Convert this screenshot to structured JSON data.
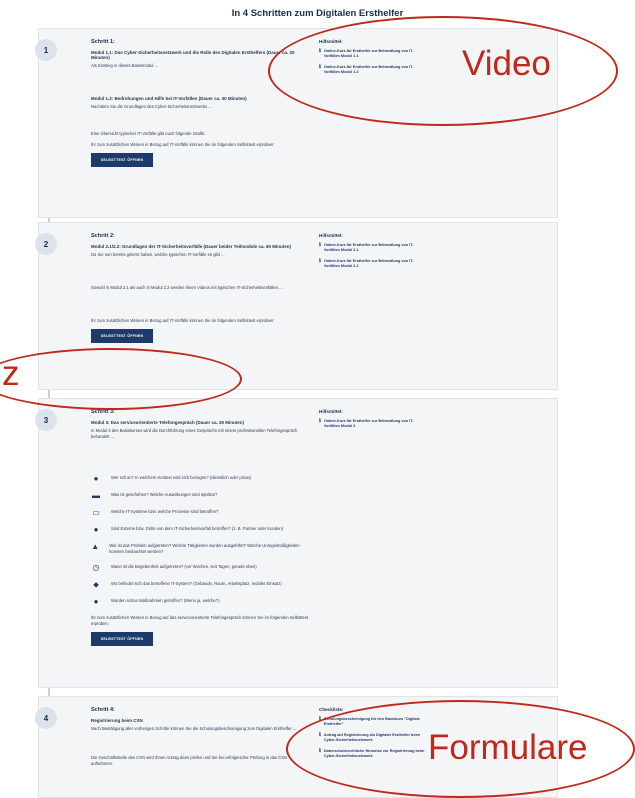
{
  "page": {
    "title": "In 4 Schritten zum Digitalen Ersthelfer"
  },
  "steps": [
    {
      "number": "1",
      "heading": "Schritt 1:",
      "sub": "Modul 1.1: Das Cyber-Sicherheitsnetzwerk und die Rolle des Digitalen Ersthelfers (Dauer ca. 20 Minuten)",
      "paragraphs": [
        "Als Einstieg in dieses Basismodul ...",
        "Modul 1.2: Bedrohungen und Hilfe bei IT-Vorfällen (Dauer ca. 30 Minuten)",
        "Nachdem Sie die Grundlagen des Cyber-Sicherheitsnetzwerks ...",
        "Eine Übersicht typischer IT-Vorfälle gibt euch folgende Grafik:",
        "Ihr zum zusätzlichen Wissen in Bezug auf IT-Vorfälle können Sie im folgenden Selbsttest erproben:"
      ],
      "button_label": "SELBSTTEST ÖFFNEN",
      "side": {
        "heading": "Hilfsmittel:",
        "items": [
          "Online-Kurs für Ersthelfer zur Behandlung von IT-Vorfällen Modul 1.1",
          "Online-Kurs für Ersthelfer zur Behandlung von IT-Vorfällen Modul 1.2"
        ]
      }
    },
    {
      "number": "2",
      "heading": "Schritt 2:",
      "sub": "Modul 2.1/2.2: Grundlagen der IT-Sicherheitsvorfälle (Dauer beider Teilmodule ca. 60 Minuten)",
      "paragraphs": [
        "Da Sie nun bereits gelernt haben, welche typischen IT-Vorfälle es gibt ...",
        "Sowohl in Modul 2.1 als auch in Modul 2.2 werden Ihnen Videos mit typischen IT-Sicherheitsvorfällen ...",
        "Ihr zum zusätzlichen Wissen in Bezug auf IT-Vorfälle können Sie im folgenden Selbsttest erproben:"
      ],
      "button_label": "SELBSTTEST ÖFFNEN",
      "side": {
        "heading": "Hilfsmittel:",
        "items": [
          "Online-Kurs für Ersthelfer zur Behandlung von IT-Vorfällen Modul 2.1",
          "Online-Kurs für Ersthelfer zur Behandlung von IT-Vorfällen Modul 2.2"
        ]
      }
    },
    {
      "number": "3",
      "heading": "Schritt 3:",
      "sub": "Modul 3: Das serviceorientierte Telefongespräch (Dauer ca. 30 Minuten)",
      "paragraphs": [
        "In Modul 3 des Basiskurses wird die Durchführung eines Gesprächs mit einem professionellen Telefongespräch behandelt ..."
      ],
      "questions": [
        "Wer ruft an? In welchem Kontext wird sich bezogen? (dienstlich oder privat)",
        "Was ist geschehen? Welche Auswirkungen sind spürbar?",
        "Welche IT-Systeme bzw. welche Prozesse sind betroffen?",
        "Sind Externe bzw. Dritte von dem IT-Sicherheitsvorfall betroffen? (z. B. Partner oder Kunden)",
        "Wie ist das Problem aufgetreten? Welche Tätigkeiten wurden ausgeführt? Welche Unregelmäßigkeiten konnten beobachtet werden?",
        "Wann ist die Begebenheit aufgetreten? (vor Wochen, seit Tagen, gerade eben)",
        "Wo befindet sich das betroffene IT-System? (Gebäude, Raum, Arbeitsplatz, mobiler Einsatz)",
        "Wurden schon Maßnahmen getroffen? (Wenn ja, welche?)"
      ],
      "outro": "Ihr zum zusätzlichen Wissen in Bezug auf das serviceorientierte Telefongespräch können Sie im folgenden Selbsttest erproben:",
      "button_label": "SELBSTTEST ÖFFNEN",
      "side": {
        "heading": "Hilfsmittel:",
        "items": [
          "Online-Kurs für Ersthelfer zur Behandlung von IT-Vorfällen Modul 3"
        ]
      }
    },
    {
      "number": "4",
      "heading": "Schritt 4:",
      "sub": "Registrierung beim CSN",
      "paragraphs": [
        "Nach Bestätigung aller vorherigen Schritte können Sie die Schulungsbescheinigung zum Digitalen Ersthelfer ...",
        "Die Geschäftsstelle des CSN wird Ihnen Antrag dann prüfen und Sie bei erfolgreicher Prüfung in das CSN aufnehmen."
      ],
      "side": {
        "heading": "Checkliste:",
        "items": [
          "Schulungsbescheinigung für den Basiskurs \"Digitale Ersthelfer\"",
          "Antrag auf Registrierung als Digitaler Ersthelfer beim Cyber-Sicherheitsnetzwerk",
          "Datenschutzrechtliche Hinweise zur Registrierung beim Cyber-Sicherheitsnetzwerk"
        ]
      }
    }
  ],
  "annotations": {
    "video_label": "Video",
    "quiz_label": "z",
    "forms_label": "Formulare",
    "color": "#c0281b"
  },
  "icons": [
    "person-icon",
    "bed-icon",
    "monitor-icon",
    "people-icon",
    "warning-icon",
    "clock-icon",
    "location-icon",
    "hand-icon"
  ]
}
